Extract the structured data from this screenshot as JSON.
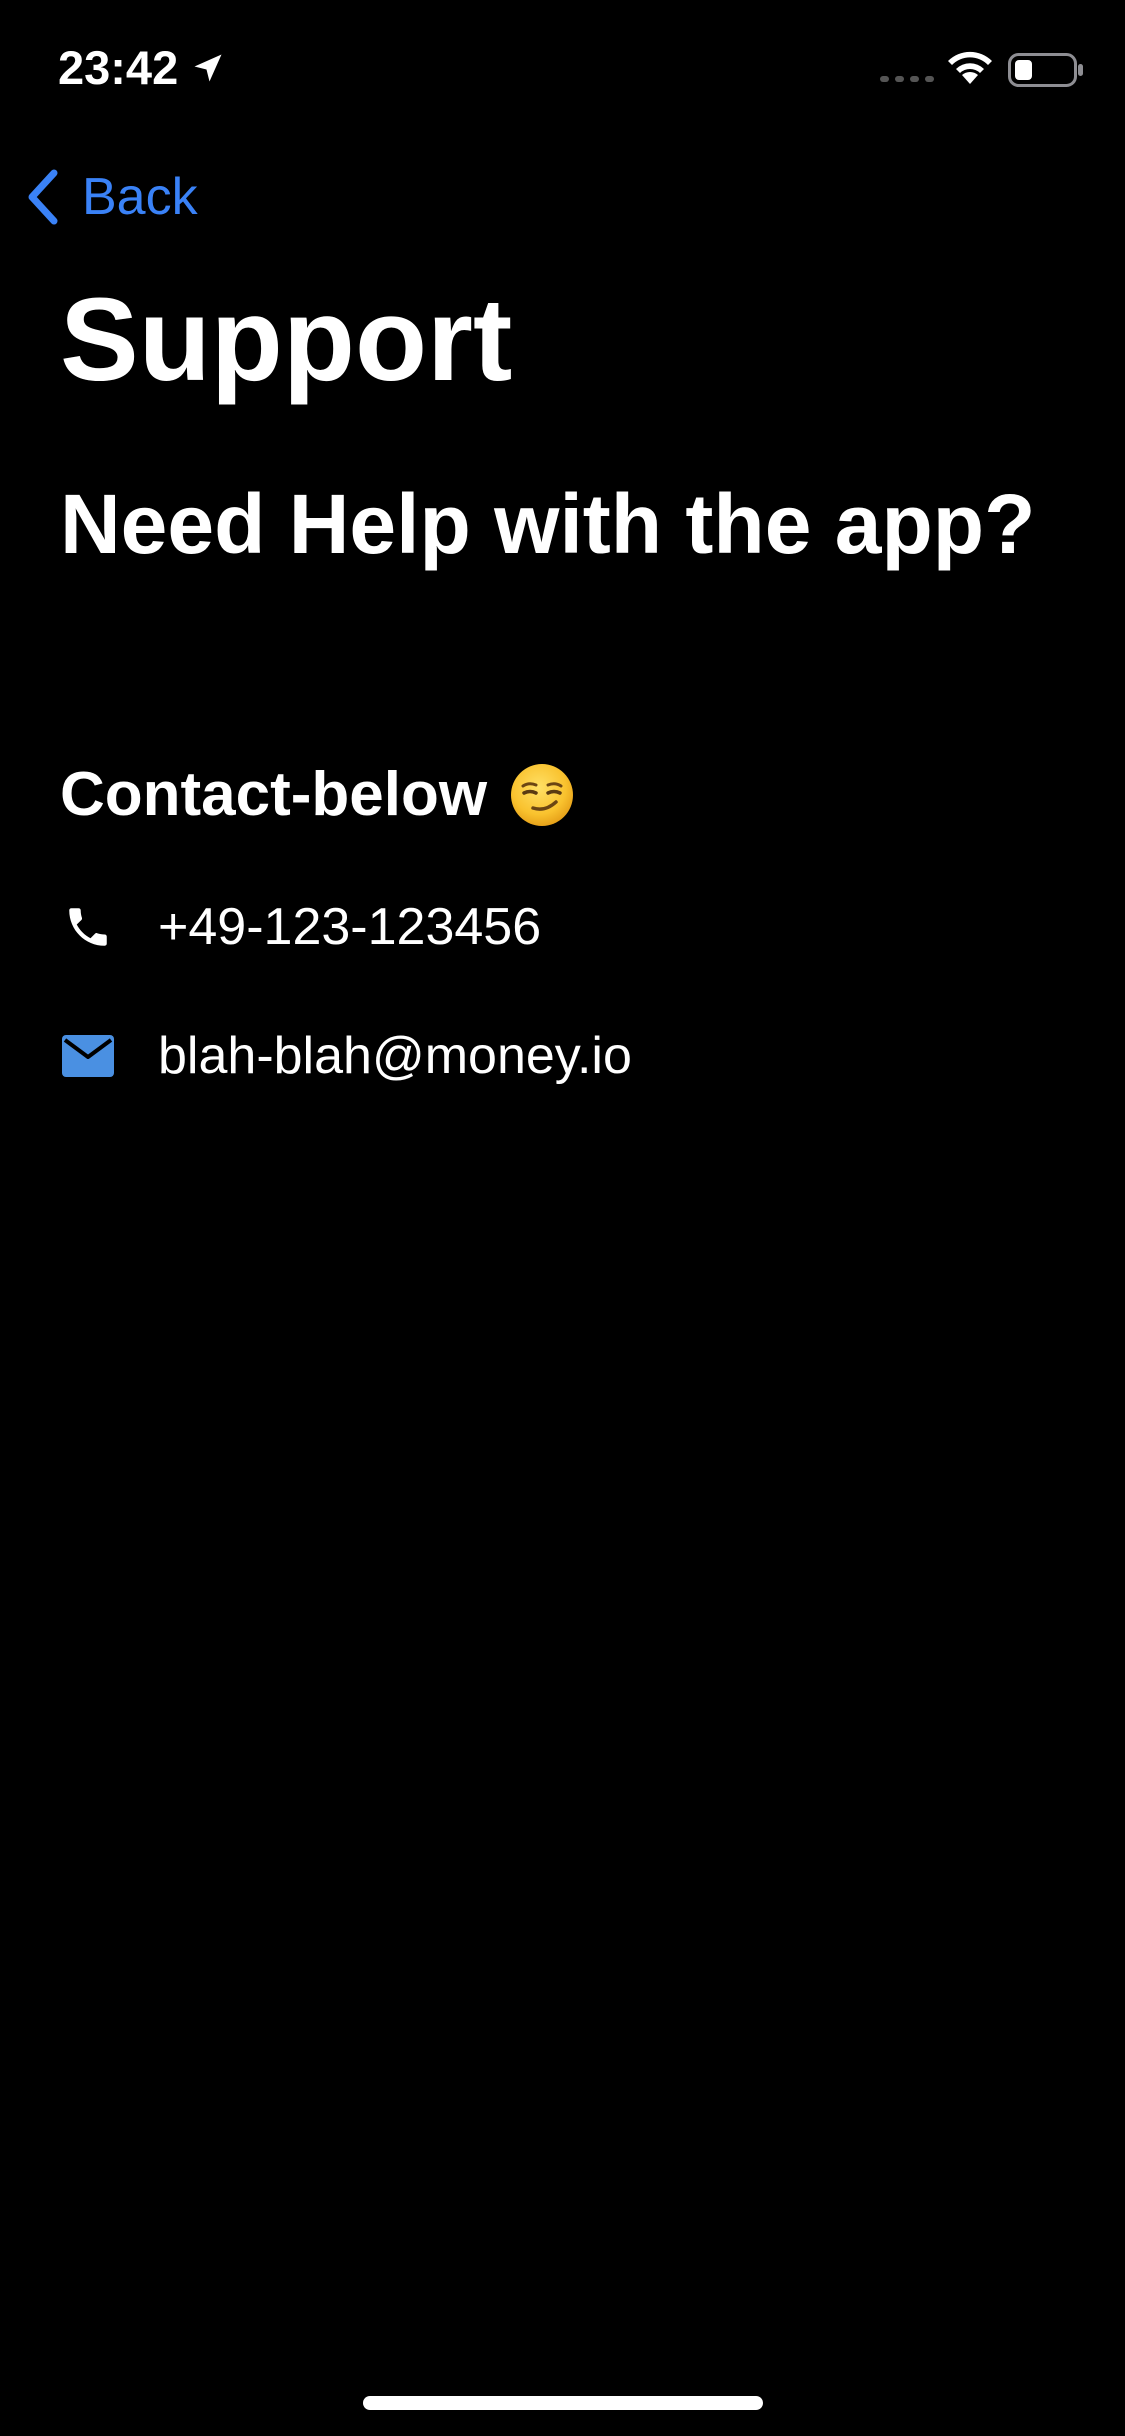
{
  "status_bar": {
    "time": "23:42",
    "location_icon": "location-arrow-icon",
    "signal_icon": "cellular-signal-icon",
    "wifi_icon": "wifi-icon",
    "battery_icon": "battery-icon"
  },
  "nav": {
    "back_label": "Back",
    "back_icon": "chevron-left-icon"
  },
  "page": {
    "title": "Support",
    "subtitle": "Need Help with the app?",
    "contact_heading": "Contact-below",
    "contact_emoji_icon": "smirking-face-emoji"
  },
  "contacts": {
    "phone": {
      "icon": "phone-icon",
      "value": "+49-123-123456"
    },
    "email": {
      "icon": "mail-icon",
      "value": "blah-blah@money.io"
    }
  },
  "colors": {
    "background": "#000000",
    "text": "#ffffff",
    "accent": "#3a82f7",
    "mail_icon": "#4a90e2"
  }
}
